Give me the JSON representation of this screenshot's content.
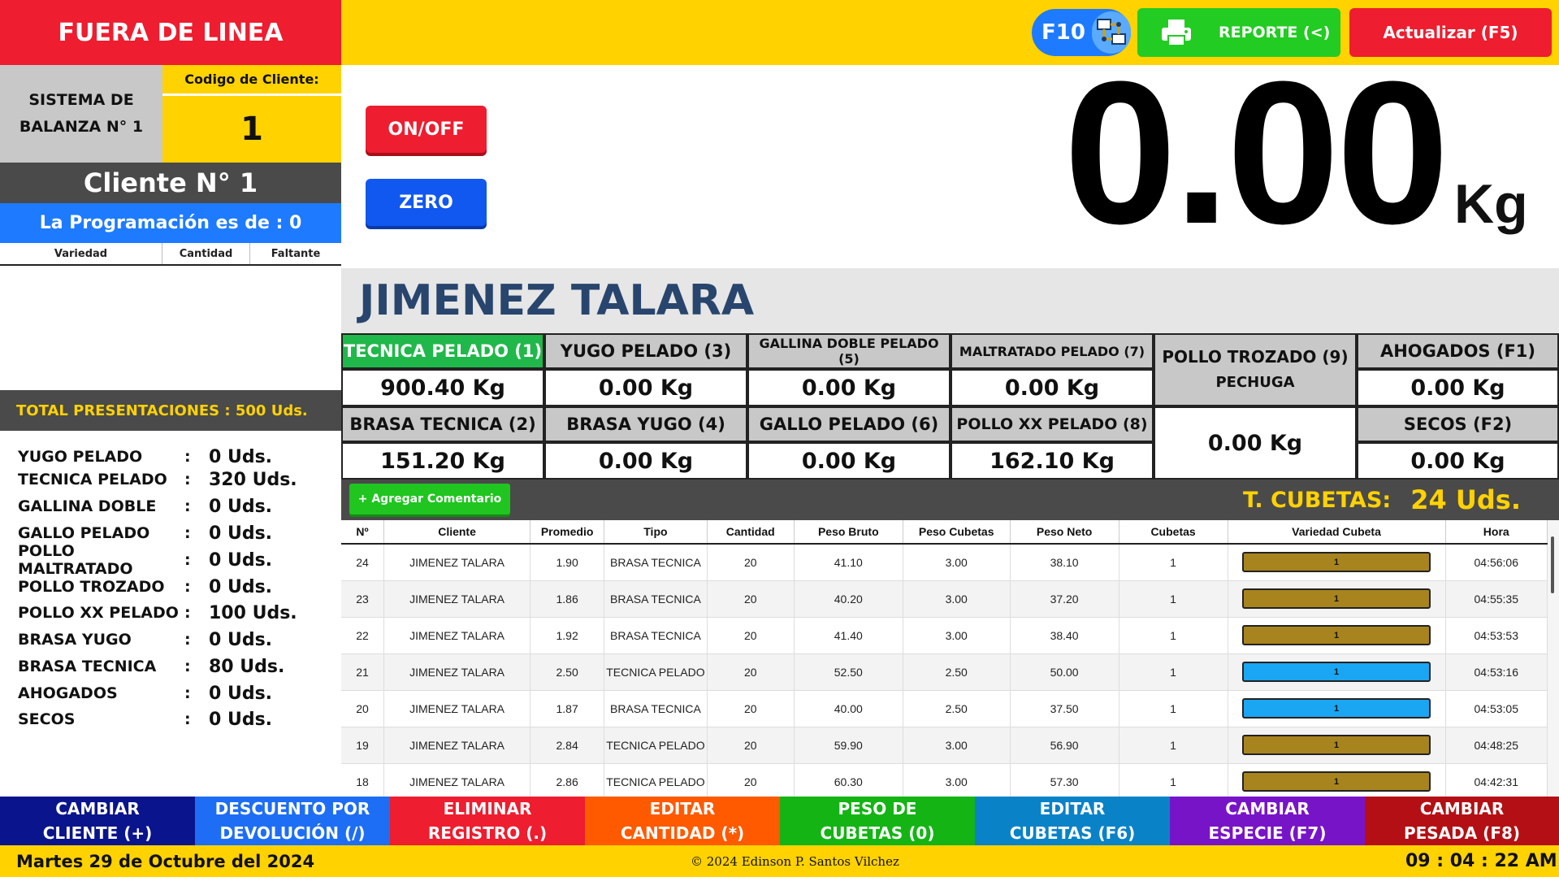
{
  "header": {
    "status": "FUERA DE LINEA",
    "system_label_line1": "SISTEMA DE",
    "system_label_line2": "BALANZA N° 1",
    "client_code_label": "Codigo de Cliente:",
    "client_code_value": "1",
    "client_name": "Cliente N° 1",
    "programming": "La Programación es de : 0",
    "programming_columns": [
      "Variedad",
      "Cantidad",
      "Faltante"
    ]
  },
  "toolbar": {
    "f10_label": "F10",
    "report_label": "REPORTE (<)",
    "refresh_label": "Actualizar (F5)"
  },
  "scale": {
    "onoff_label": "ON/OFF",
    "zero_label": "ZERO",
    "weight": "0.00",
    "unit": "Kg"
  },
  "client_header": "JIMENEZ TALARA",
  "varieties": [
    {
      "label": "TECNICA PELADO (1)",
      "value": "900.40 Kg"
    },
    {
      "label": "YUGO PELADO (3)",
      "value": "0.00 Kg"
    },
    {
      "label": "GALLINA DOBLE PELADO (5)",
      "value": "0.00 Kg"
    },
    {
      "label": "MALTRATADO PELADO (7)",
      "value": "0.00 Kg"
    },
    {
      "label": "POLLO TROZADO (9)",
      "sublabel": "PECHUGA",
      "value": "0.00 Kg"
    },
    {
      "label": "AHOGADOS (F1)",
      "value": "0.00 Kg"
    },
    {
      "label": "BRASA TECNICA (2)",
      "value": "151.20 Kg"
    },
    {
      "label": "BRASA YUGO (4)",
      "value": "0.00 Kg"
    },
    {
      "label": "GALLO PELADO (6)",
      "value": "0.00 Kg"
    },
    {
      "label": "POLLO XX PELADO (8)",
      "value": "162.10 Kg"
    },
    {
      "label": "SECOS (F2)",
      "value": "0.00 Kg"
    }
  ],
  "comment_button": "+ Agregar Comentario",
  "cubetas_total": {
    "label": "T. CUBETAS:",
    "value": "24 Uds."
  },
  "table": {
    "columns": [
      "Nº",
      "Cliente",
      "Promedio",
      "Tipo",
      "Cantidad",
      "Peso Bruto",
      "Peso Cubetas",
      "Peso Neto",
      "Cubetas",
      "Variedad Cubeta",
      "Hora"
    ],
    "rows": [
      {
        "n": "24",
        "cliente": "JIMENEZ TALARA",
        "promedio": "1.90",
        "tipo": "BRASA TECNICA",
        "cantidad": "20",
        "bruto": "41.10",
        "cubetas_peso": "3.00",
        "neto": "38.10",
        "cubetas": "1",
        "variedad": "1",
        "color": "#a8841e",
        "hora": "04:56:06"
      },
      {
        "n": "23",
        "cliente": "JIMENEZ TALARA",
        "promedio": "1.86",
        "tipo": "BRASA TECNICA",
        "cantidad": "20",
        "bruto": "40.20",
        "cubetas_peso": "3.00",
        "neto": "37.20",
        "cubetas": "1",
        "variedad": "1",
        "color": "#a8841e",
        "hora": "04:55:35"
      },
      {
        "n": "22",
        "cliente": "JIMENEZ TALARA",
        "promedio": "1.92",
        "tipo": "BRASA TECNICA",
        "cantidad": "20",
        "bruto": "41.40",
        "cubetas_peso": "3.00",
        "neto": "38.40",
        "cubetas": "1",
        "variedad": "1",
        "color": "#a8841e",
        "hora": "04:53:53"
      },
      {
        "n": "21",
        "cliente": "JIMENEZ TALARA",
        "promedio": "2.50",
        "tipo": "TECNICA PELADO",
        "cantidad": "20",
        "bruto": "52.50",
        "cubetas_peso": "2.50",
        "neto": "50.00",
        "cubetas": "1",
        "variedad": "1",
        "color": "#1aa6f2",
        "hora": "04:53:16"
      },
      {
        "n": "20",
        "cliente": "JIMENEZ TALARA",
        "promedio": "1.87",
        "tipo": "BRASA TECNICA",
        "cantidad": "20",
        "bruto": "40.00",
        "cubetas_peso": "2.50",
        "neto": "37.50",
        "cubetas": "1",
        "variedad": "1",
        "color": "#1aa6f2",
        "hora": "04:53:05"
      },
      {
        "n": "19",
        "cliente": "JIMENEZ TALARA",
        "promedio": "2.84",
        "tipo": "TECNICA PELADO",
        "cantidad": "20",
        "bruto": "59.90",
        "cubetas_peso": "3.00",
        "neto": "56.90",
        "cubetas": "1",
        "variedad": "1",
        "color": "#a8841e",
        "hora": "04:48:25"
      },
      {
        "n": "18",
        "cliente": "JIMENEZ TALARA",
        "promedio": "2.86",
        "tipo": "TECNICA PELADO",
        "cantidad": "20",
        "bruto": "60.30",
        "cubetas_peso": "3.00",
        "neto": "57.30",
        "cubetas": "1",
        "variedad": "1",
        "color": "#a8841e",
        "hora": "04:42:31"
      }
    ]
  },
  "presentations": {
    "total": "TOTAL PRESENTACIONES :  500 Uds.",
    "items": [
      {
        "name": "YUGO PELADO",
        "value": "0 Uds."
      },
      {
        "name": "TECNICA PELADO",
        "value": "320 Uds."
      },
      {
        "name": "GALLINA DOBLE",
        "value": "0 Uds."
      },
      {
        "name": "GALLO PELADO",
        "value": "0 Uds."
      },
      {
        "name": "POLLO MALTRATADO",
        "value": "0 Uds."
      },
      {
        "name": "POLLO TROZADO",
        "value": "0 Uds."
      },
      {
        "name": "POLLO XX PELADO",
        "value": "100 Uds."
      },
      {
        "name": "BRASA YUGO",
        "value": "0 Uds."
      },
      {
        "name": "BRASA TECNICA",
        "value": "80 Uds."
      },
      {
        "name": "AHOGADOS",
        "value": "0 Uds."
      },
      {
        "name": "SECOS",
        "value": "0 Uds."
      }
    ]
  },
  "actions": [
    {
      "line1": "CAMBIAR",
      "line2": "CLIENTE (+)",
      "color": "#0a148c"
    },
    {
      "line1": "DESCUENTO POR",
      "line2": "DEVOLUCIÓN (/)",
      "color": "#1e6ef5"
    },
    {
      "line1": "ELIMINAR",
      "line2": "REGISTRO (.)",
      "color": "#ee1d2f"
    },
    {
      "line1": "EDITAR",
      "line2": "CANTIDAD (*)",
      "color": "#ff5a00"
    },
    {
      "line1": "PESO DE",
      "line2": "CUBETAS (0)",
      "color": "#14b414"
    },
    {
      "line1": "EDITAR",
      "line2": "CUBETAS (F6)",
      "color": "#0a82c8"
    },
    {
      "line1": "CAMBIAR",
      "line2": "ESPECIE (F7)",
      "color": "#7814c8"
    },
    {
      "line1": "CAMBIAR",
      "line2": "PESADA (F8)",
      "color": "#b40f14"
    }
  ],
  "footer": {
    "date": "Martes 29 de Octubre del 2024",
    "copyright": "© 2024 Edinson P. Santos Vilchez",
    "time": "09 : 04 : 22 AM"
  }
}
